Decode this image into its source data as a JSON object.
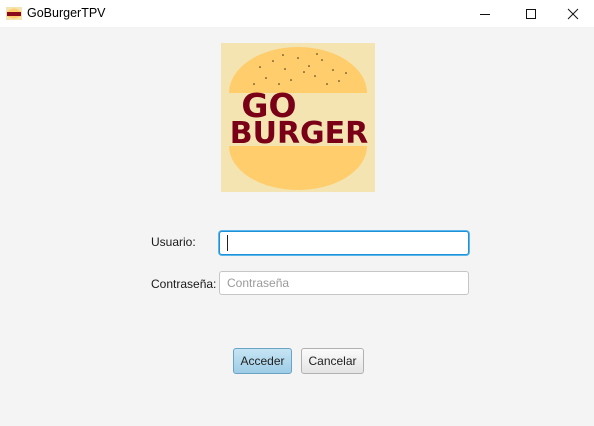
{
  "window": {
    "title": "GoBurgerTPV"
  },
  "logo": {
    "line1": "GO",
    "line2": "BURGER",
    "colors": {
      "background": "#f3e4b2",
      "bun": "#ffcd6c",
      "text": "#7a0018",
      "seeds": "#3a2a10"
    }
  },
  "form": {
    "user_label": "Usuario:",
    "user_value": "",
    "password_label": "Contraseña:",
    "password_placeholder": "Contraseña"
  },
  "buttons": {
    "accept_label": "Acceder",
    "cancel_label": "Cancelar"
  },
  "colors": {
    "focus_border": "#1f8fd6",
    "accept_button": "#a9d4ec",
    "window_background": "#f4f4f4"
  },
  "icons": {
    "app": "burger-app-icon",
    "minimize": "minimize-icon",
    "maximize": "maximize-icon",
    "close": "close-icon"
  }
}
